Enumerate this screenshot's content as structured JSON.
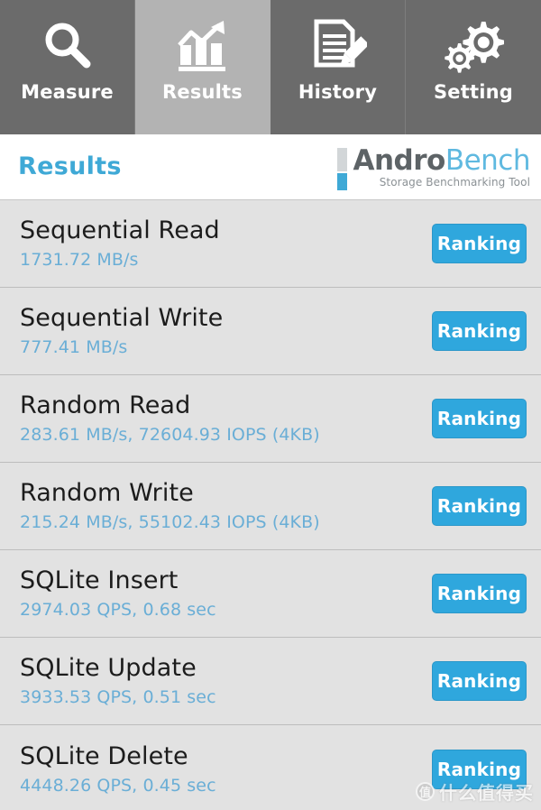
{
  "tabs": [
    {
      "label": "Measure",
      "icon": "search-icon",
      "active": false
    },
    {
      "label": "Results",
      "icon": "bar-chart-trend-icon",
      "active": true
    },
    {
      "label": "History",
      "icon": "document-pencil-icon",
      "active": false
    },
    {
      "label": "Setting",
      "icon": "gears-icon",
      "active": false
    }
  ],
  "header": {
    "title": "Results",
    "logo": {
      "word_primary": "Andro",
      "word_secondary": "Bench",
      "tagline": "Storage Benchmarking Tool"
    }
  },
  "results": {
    "action_label": "Ranking",
    "rows": [
      {
        "name": "Sequential Read",
        "value": "1731.72 MB/s"
      },
      {
        "name": "Sequential Write",
        "value": "777.41 MB/s"
      },
      {
        "name": "Random Read",
        "value": "283.61 MB/s, 72604.93 IOPS (4KB)"
      },
      {
        "name": "Random Write",
        "value": "215.24 MB/s, 55102.43 IOPS (4KB)"
      },
      {
        "name": "SQLite Insert",
        "value": "2974.03 QPS, 0.68 sec"
      },
      {
        "name": "SQLite Update",
        "value": "3933.53 QPS, 0.51 sec"
      },
      {
        "name": "SQLite Delete",
        "value": "4448.26 QPS, 0.45 sec"
      }
    ]
  },
  "watermark": {
    "badge": "值",
    "text": "什么值得买"
  },
  "colors": {
    "accent_blue": "#2fa7dd",
    "title_blue": "#3fa9d6",
    "value_blue": "#6aaed6",
    "tabbar_gray": "#6b6b6b",
    "tab_active_gray": "#b3b3b3",
    "list_bg": "#e2e2e2"
  }
}
